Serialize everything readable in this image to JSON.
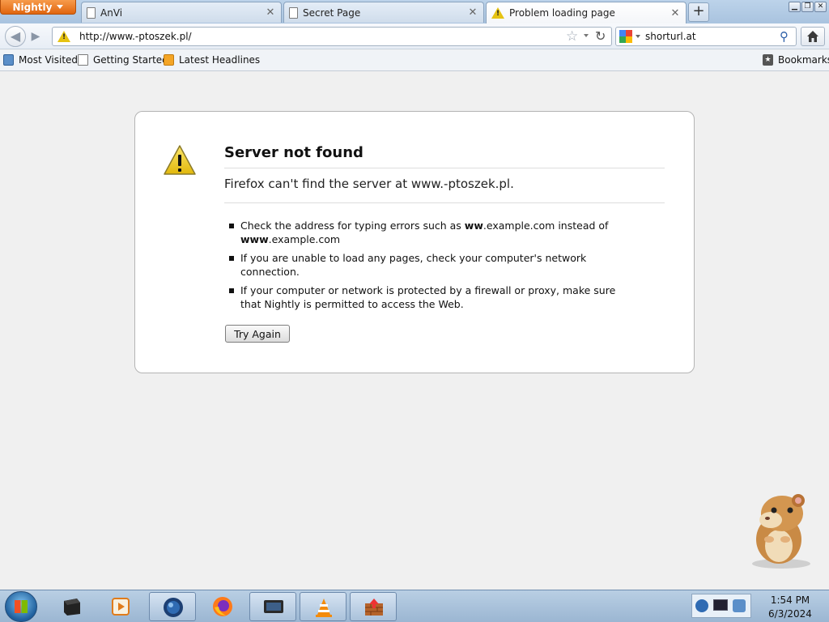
{
  "browser": {
    "app_menu_label": "Nightly",
    "tabs": [
      {
        "label": "AnVi",
        "icon": "page-icon"
      },
      {
        "label": "Secret Page",
        "icon": "page-icon"
      },
      {
        "label": "Problem loading page",
        "icon": "warning-icon"
      }
    ],
    "url": "http://www.-ptoszek.pl/",
    "search_query": "shorturl.at",
    "bookmarks": [
      {
        "label": "Most Visited",
        "icon": "smart-folder-icon"
      },
      {
        "label": "Getting Started",
        "icon": "page-icon"
      },
      {
        "label": "Latest Headlines",
        "icon": "rss-feed-icon"
      }
    ],
    "bookmarks_menu_label": "Bookmarks"
  },
  "error_page": {
    "title": "Server not found",
    "short_desc": "Firefox can't find the server at www.-ptoszek.pl.",
    "suggestions": {
      "typo_prefix": "Check the address for typing errors such as ",
      "typo_bad_bold": "ww",
      "typo_bad_rest": ".example.com instead of ",
      "typo_good_bold": "www",
      "typo_good_rest": ".example.com",
      "network": "If you are unable to load any pages, check your computer's network connection.",
      "firewall": "If your computer or network is protected by a firewall or proxy, make sure that Nightly is permitted to access the Web."
    },
    "try_again_label": "Try Again"
  },
  "taskbar": {
    "items": [
      {
        "name": "terminal-app-icon",
        "active": false
      },
      {
        "name": "media-player-app-icon",
        "active": false
      },
      {
        "name": "globe-app-icon",
        "active": true
      },
      {
        "name": "firefox-app-icon",
        "active": false
      },
      {
        "name": "monitor-app-icon",
        "active": true
      },
      {
        "name": "vlc-app-icon",
        "active": true
      },
      {
        "name": "firewall-app-icon",
        "active": true
      }
    ],
    "clock_time": "1:54 PM",
    "clock_date": "6/3/2024"
  },
  "colors": {
    "app_button": "#e66a12",
    "warning": "#e6c312",
    "taskbar": "#a9c2dc"
  }
}
